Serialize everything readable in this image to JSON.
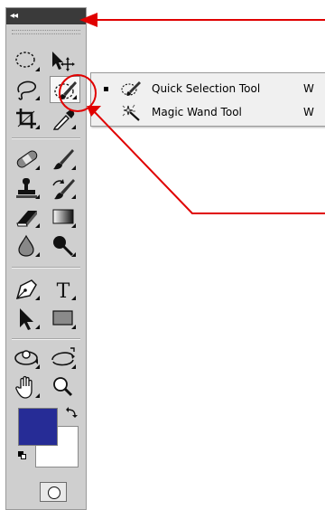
{
  "panel": {
    "collapse_glyph": "◂◂",
    "collapse_icon": "double-left-arrow-icon"
  },
  "tools": [
    {
      "name": "rectangular-marquee-tool",
      "icon": "marquee-icon"
    },
    {
      "name": "move-tool",
      "icon": "move-icon"
    },
    {
      "name": "lasso-tool",
      "icon": "lasso-icon"
    },
    {
      "name": "quick-selection-tool",
      "icon": "quick-selection-brush-icon",
      "active": true
    },
    {
      "name": "crop-tool",
      "icon": "crop-icon"
    },
    {
      "name": "eyedropper-tool",
      "icon": "eyedropper-icon"
    },
    {
      "name": "healing-brush-tool",
      "icon": "bandage-icon"
    },
    {
      "name": "brush-tool",
      "icon": "brush-icon"
    },
    {
      "name": "clone-stamp-tool",
      "icon": "stamp-icon"
    },
    {
      "name": "history-brush-tool",
      "icon": "history-brush-icon"
    },
    {
      "name": "eraser-tool",
      "icon": "eraser-icon"
    },
    {
      "name": "gradient-tool",
      "icon": "gradient-icon"
    },
    {
      "name": "blur-tool",
      "icon": "drop-icon"
    },
    {
      "name": "dodge-tool",
      "icon": "dodge-icon"
    },
    {
      "name": "pen-tool",
      "icon": "pen-icon"
    },
    {
      "name": "type-tool",
      "icon": "type-icon",
      "glyph": "T"
    },
    {
      "name": "path-selection-tool",
      "icon": "arrow-icon"
    },
    {
      "name": "shape-tool",
      "icon": "rectangle-icon"
    },
    {
      "name": "3d-rotate-tool",
      "icon": "3d-rotate-icon"
    },
    {
      "name": "3d-orbit-tool",
      "icon": "3d-orbit-icon"
    },
    {
      "name": "hand-tool",
      "icon": "hand-icon"
    },
    {
      "name": "zoom-tool",
      "icon": "magnifier-icon"
    }
  ],
  "colors": {
    "foreground": "#262c96",
    "background": "#ffffff",
    "annotation": "#e00000",
    "titlebar": "#3a3a3a"
  },
  "flyout": {
    "items": [
      {
        "label": "Quick Selection Tool",
        "shortcut": "W",
        "icon": "quick-selection-brush-icon",
        "selected": true
      },
      {
        "label": "Magic Wand Tool",
        "shortcut": "W",
        "icon": "magic-wand-icon",
        "selected": false
      }
    ]
  }
}
